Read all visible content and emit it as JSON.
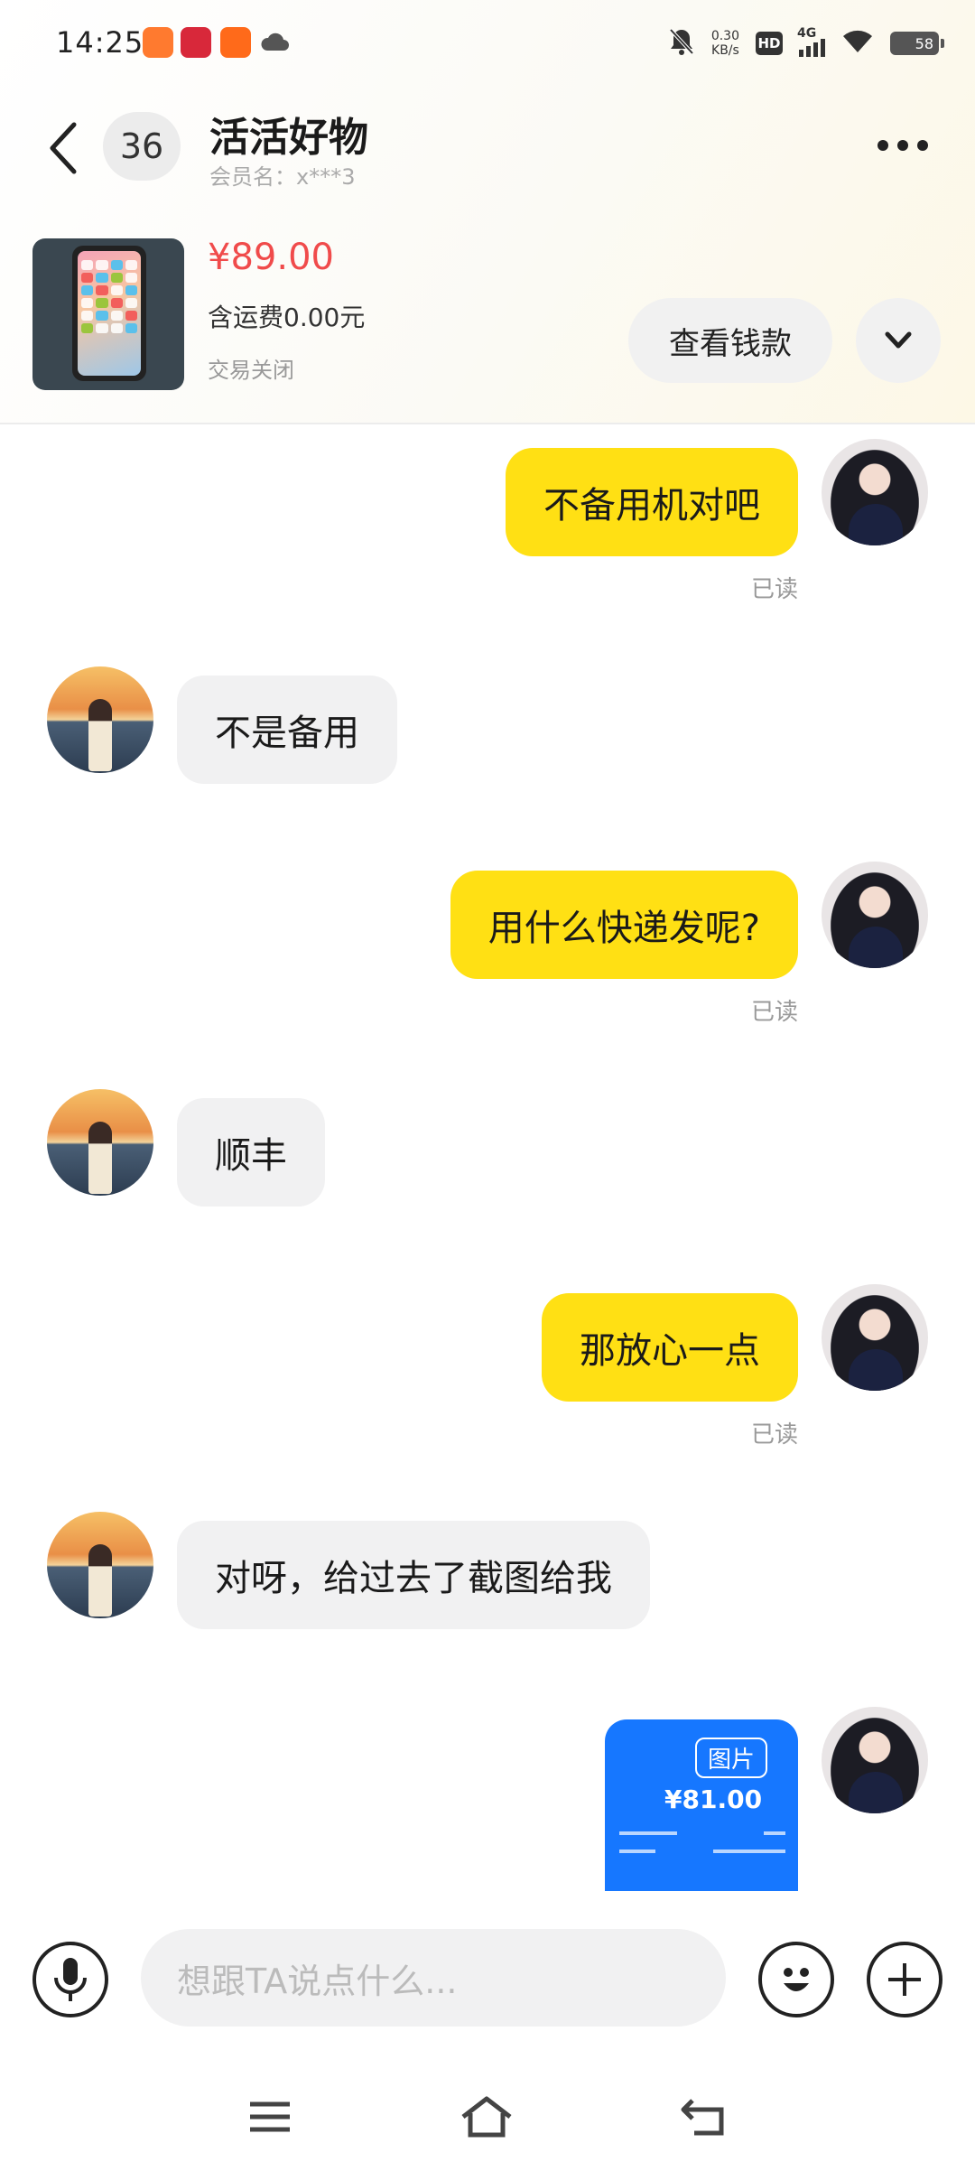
{
  "status_bar": {
    "time": "14:25",
    "net_speed_value": "0.30",
    "net_speed_unit": "KB/s",
    "hd_label": "HD",
    "network_label": "4G",
    "battery_level": "58",
    "icons": [
      "app-icon-orange",
      "app-icon-red",
      "app-icon-orange",
      "cloud-icon",
      "bell-muted-icon",
      "wifi-icon"
    ]
  },
  "header": {
    "unread_count": "36",
    "peer_name": "活活好物",
    "member_label": "会员名：x***3"
  },
  "product": {
    "price": "¥89.00",
    "shipping": "含运费0.00元",
    "status": "交易关闭",
    "view_button": "查看钱款"
  },
  "messages": [
    {
      "from": "self",
      "text": "不备用机对吧",
      "read": "已读"
    },
    {
      "from": "peer",
      "text": "不是备用"
    },
    {
      "from": "self",
      "text": "用什么快递发呢?",
      "read": "已读"
    },
    {
      "from": "peer",
      "text": "顺丰"
    },
    {
      "from": "self",
      "text": "那放心一点",
      "read": "已读"
    },
    {
      "from": "peer",
      "text": "对呀，给过去了截图给我"
    },
    {
      "from": "self",
      "type": "image",
      "label": "图片",
      "amount": "¥81.00"
    }
  ],
  "input_bar": {
    "placeholder": "想跟TA说点什么..."
  },
  "colors": {
    "self_bubble": "#ffe014",
    "peer_bubble": "#f1f1f2",
    "price": "#f04b4b",
    "image_msg": "#1677ff"
  }
}
